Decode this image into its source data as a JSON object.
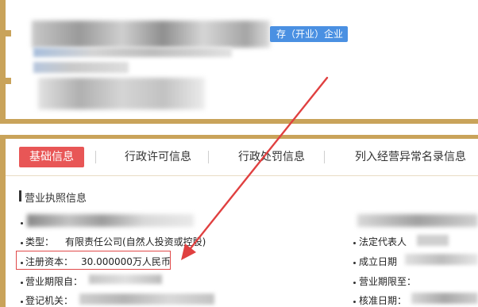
{
  "header": {
    "status_badge": "存（开业）企业"
  },
  "tabs": [
    {
      "label": "基础信息"
    },
    {
      "label": "行政许可信息"
    },
    {
      "label": "行政处罚信息"
    },
    {
      "label": "列入经营异常名录信息"
    }
  ],
  "section": {
    "title": "营业执照信息"
  },
  "fields": {
    "type_label": "类型：",
    "type_value": "有限责任公司(自然人投资或控股)",
    "legal_rep_label": "法定代表人",
    "capital_label": "注册资本：",
    "capital_value": "30.000000万人民币",
    "established_label": "成立日期",
    "term_start_label": "营业期限自：",
    "term_end_label": "营业期限至：",
    "authority_label": "登记机关：",
    "approval_label": "核准日期："
  },
  "colors": {
    "accent_gold": "#c9a35a",
    "active_tab": "#e85656",
    "badge_blue": "#4a90e2",
    "highlight_red": "#e04a4a"
  }
}
